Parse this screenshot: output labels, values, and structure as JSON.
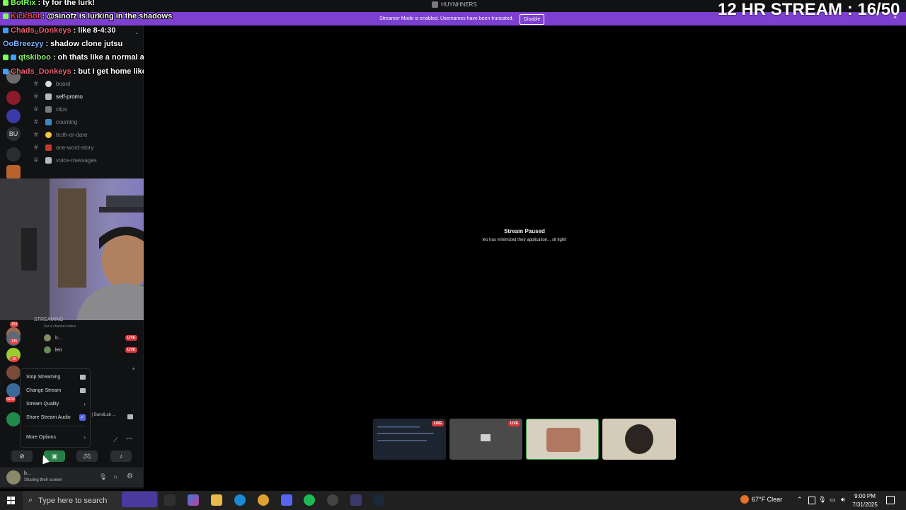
{
  "window": {
    "title": "HUYNHNERS"
  },
  "banner": {
    "text": "Streamer Mode is enabled. Usernames have been truncated.",
    "button": "Disable",
    "close": "×"
  },
  "overlay": {
    "stream_counter": "12 HR STREAM : 16/50"
  },
  "chat": [
    {
      "user": "BotRix",
      "message": "ty for the lurk!",
      "color": "#7cff5a"
    },
    {
      "user": "KickBot",
      "message": "@sinofz is lurking in the shadows",
      "color": "#e84a4a"
    },
    {
      "user": "Chads_Donkeys",
      "message": "like 8-4:30",
      "color": "#f06272"
    },
    {
      "user": "OoBreezyy",
      "message": "shadow clone jutsu",
      "color": "#7fb2ff"
    },
    {
      "user": "qtskiboo",
      "message": "oh thats like a normal ass shift",
      "color": "#8cf26b"
    },
    {
      "user": "Chads_Donkeys",
      "message": "but I get home like at 5 or 6",
      "color": "#f06272"
    }
  ],
  "server": {
    "name": "HUYNHNERS",
    "rail_label": "BU"
  },
  "channels": [
    {
      "name": "board",
      "emoji_color": "#dcdcdc",
      "active": false
    },
    {
      "name": "self-promo",
      "emoji_color": "#b5bac1",
      "active": true
    },
    {
      "name": "clips",
      "emoji_color": "#7a7a7a",
      "active": false
    },
    {
      "name": "counting",
      "emoji_color": "#3b88c3",
      "active": false
    },
    {
      "name": "truth-or-dare",
      "emoji_color": "#f4c542",
      "active": false
    },
    {
      "name": "one-word-story",
      "emoji_color": "#c0392b",
      "active": false
    },
    {
      "name": "voice-messages",
      "emoji_color": "#b5bac1",
      "active": false
    }
  ],
  "voice": {
    "channel": "STREAMING",
    "status_placeholder": "Set a channel status",
    "users": [
      {
        "name": "b...",
        "live": "LIVE"
      },
      {
        "name": "leo",
        "live": "LIVE"
      }
    ],
    "activity": "r | BandLab ..."
  },
  "rail_badges": [
    "104",
    "145",
    "26",
    "NEW"
  ],
  "context_menu": {
    "items": [
      "Stop Streaming",
      "Change Stream",
      "Stream Quality",
      "Share Stream Audio",
      "More Options"
    ]
  },
  "user": {
    "name": "b...",
    "status": "Sharing their screen"
  },
  "stream": {
    "paused_title": "Stream Paused",
    "paused_message": "leo has minimized their application... sit tight!"
  },
  "tiles": [
    {
      "label": "LIVE"
    },
    {
      "label": "LIVE"
    }
  ],
  "taskbar": {
    "search_placeholder": "Type here to search",
    "weather": "67°F  Clear",
    "time": "9:00 PM",
    "date": "7/31/2025"
  },
  "colors": {
    "banner": "#7c3fd0",
    "accent": "#5865f2",
    "live": "#da373c"
  }
}
